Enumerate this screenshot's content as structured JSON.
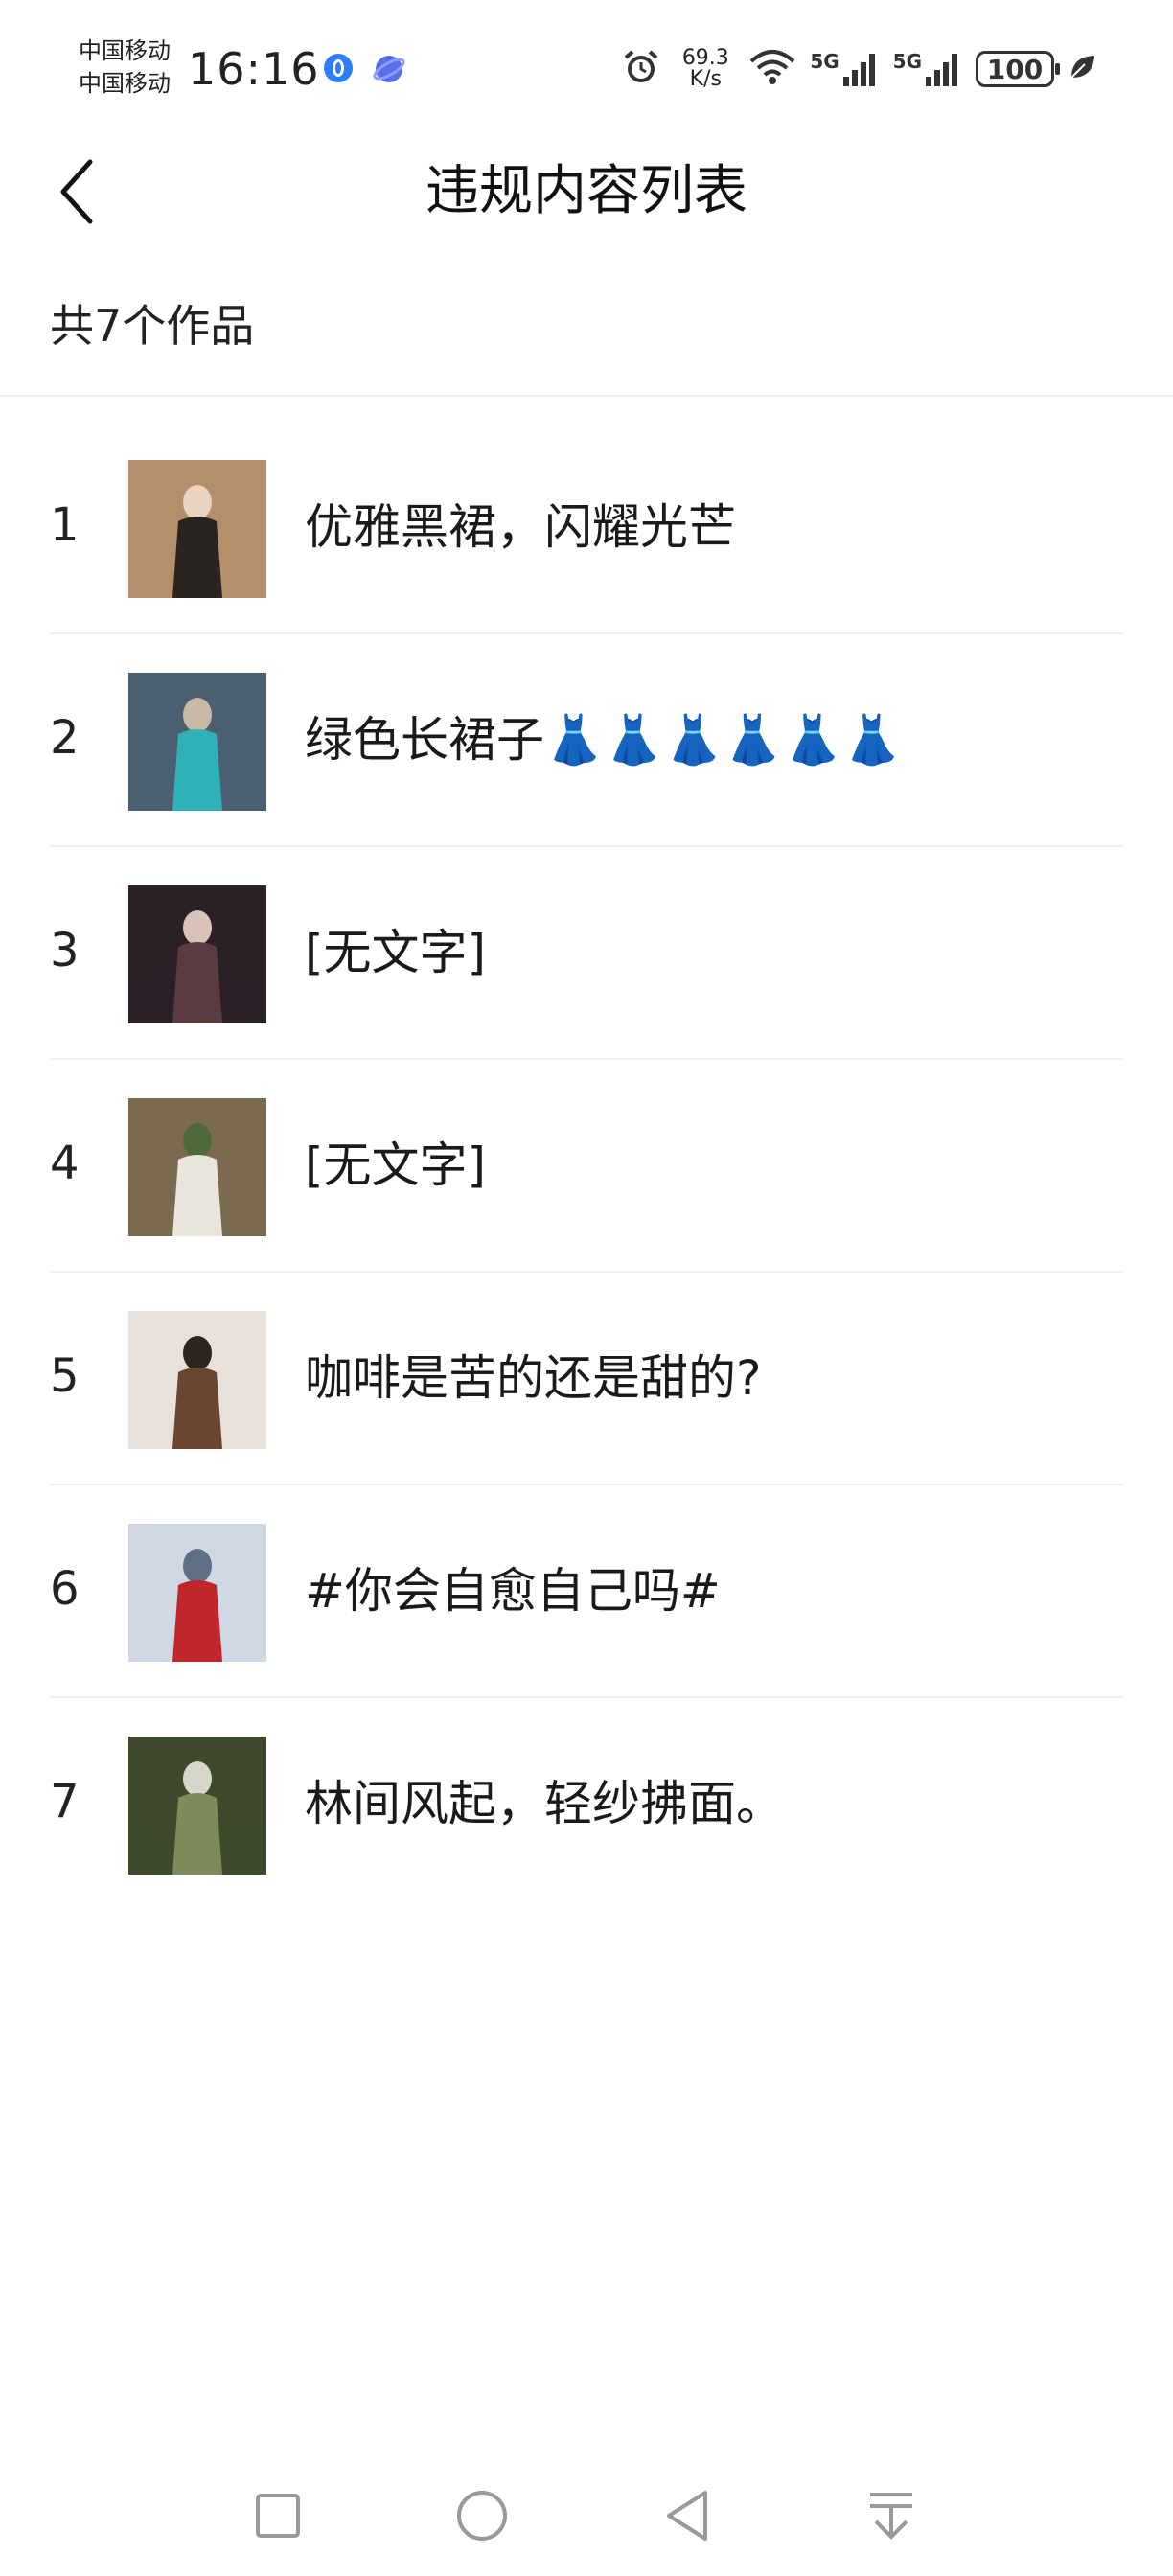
{
  "status_bar": {
    "carrier_1": "中国移动",
    "carrier_2": "中国移动",
    "time": "16:16",
    "net_speed_value": "69.3",
    "net_speed_unit": "K/s",
    "network_1": "5G",
    "network_2": "5G",
    "battery": "100",
    "icons": [
      "app-notification-icon",
      "planet-icon",
      "alarm-icon",
      "wifi-icon",
      "signal-icon",
      "signal-icon",
      "battery-icon",
      "leaf-icon"
    ]
  },
  "header": {
    "title": "违规内容列表",
    "back_icon": "back-chevron-icon"
  },
  "summary": {
    "count_label": "共7个作品"
  },
  "items": [
    {
      "index": "1",
      "title": "优雅黑裙，闪耀光芒",
      "thumb_colors": [
        "#b58e6b",
        "#2a2420",
        "#e8d2c0"
      ]
    },
    {
      "index": "2",
      "title": "绿色长裙子👗👗👗👗👗👗",
      "thumb_colors": [
        "#4b5f73",
        "#2fb1b8",
        "#c8b9a6"
      ]
    },
    {
      "index": "3",
      "title": "[无文字]",
      "thumb_colors": [
        "#2b2026",
        "#5a3b40",
        "#d9c2b8"
      ]
    },
    {
      "index": "4",
      "title": "[无文字]",
      "thumb_colors": [
        "#7b6a4f",
        "#e9e4dc",
        "#4f6a3a"
      ]
    },
    {
      "index": "5",
      "title": "咖啡是苦的还是甜的?",
      "thumb_colors": [
        "#e8e1da",
        "#6a4530",
        "#2f2520"
      ]
    },
    {
      "index": "6",
      "title": "#你会自愈自己吗#",
      "thumb_colors": [
        "#cfd8e4",
        "#c0262c",
        "#5f6f86"
      ]
    },
    {
      "index": "7",
      "title": "林间风起，轻纱拂面。",
      "thumb_colors": [
        "#3f4a2c",
        "#7d8a5a",
        "#d8d6cc"
      ]
    }
  ],
  "nav_bar": {
    "icons": [
      "recent-apps-square-icon",
      "home-circle-icon",
      "back-triangle-icon",
      "notification-drawer-icon"
    ]
  }
}
